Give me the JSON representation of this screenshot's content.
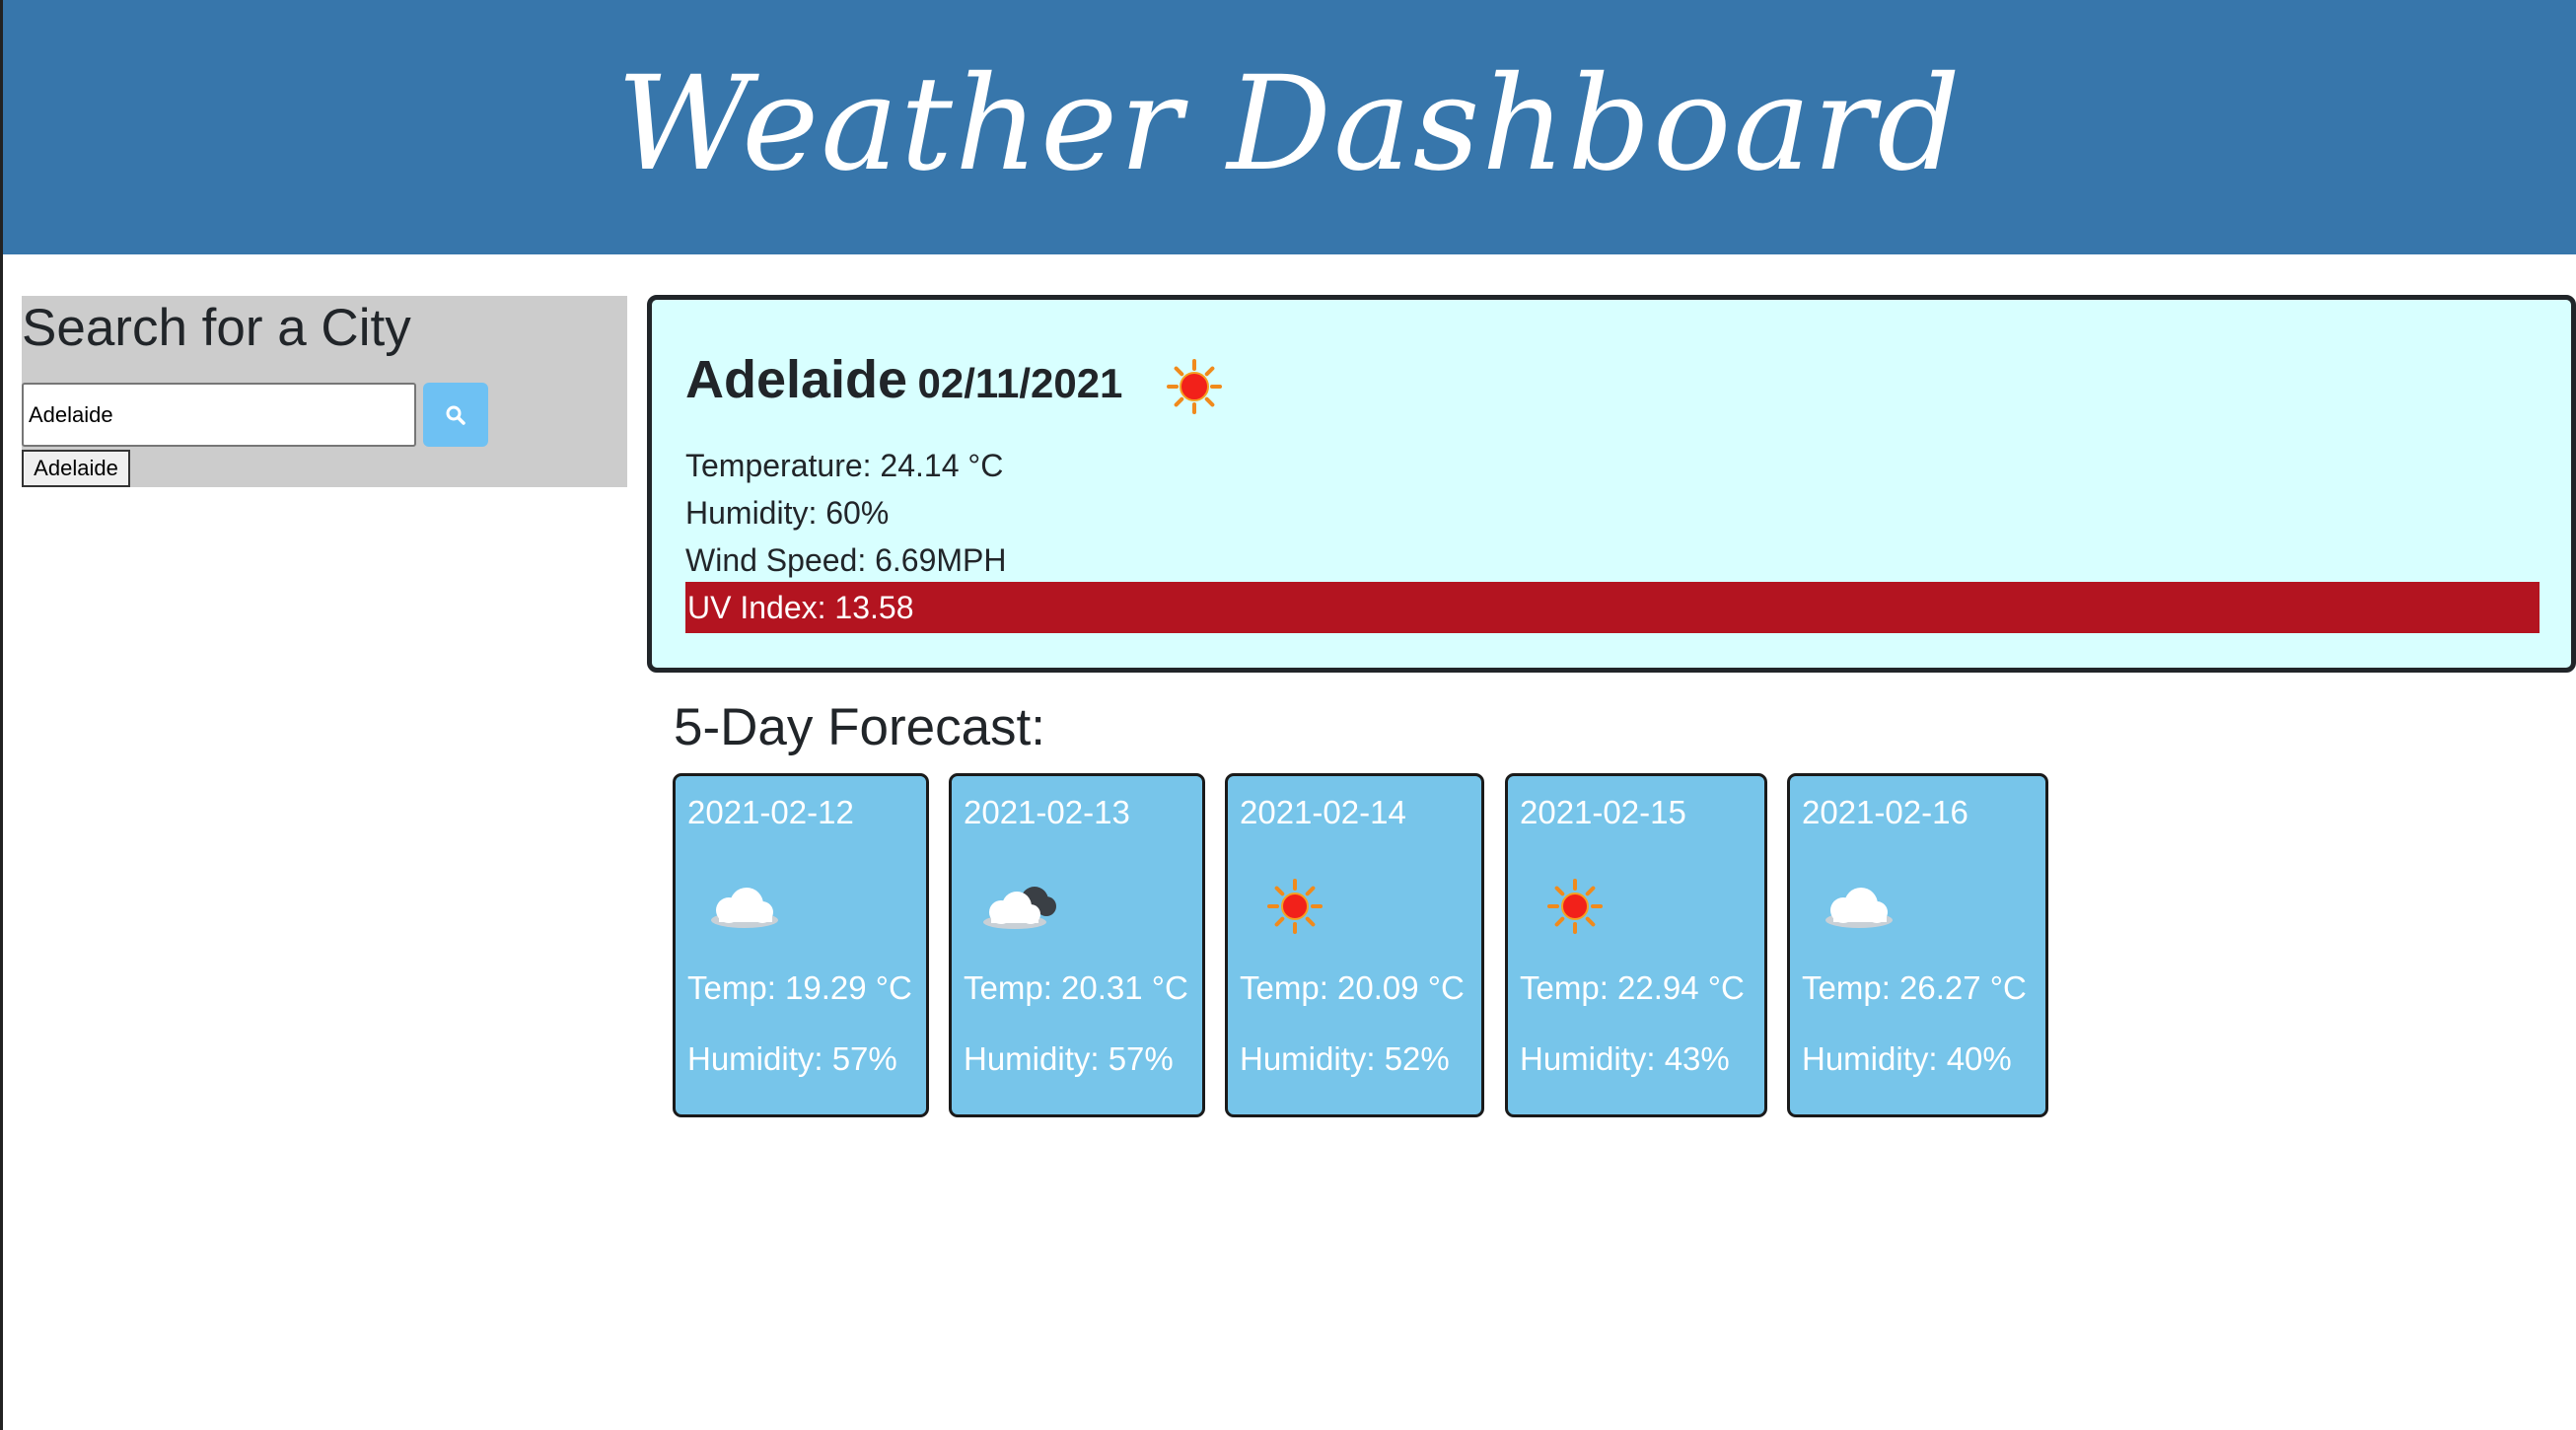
{
  "header": {
    "title": "Weather Dashboard"
  },
  "search": {
    "heading": "Search for a City",
    "input_value": "Adelaide",
    "button_icon": "search-icon",
    "history": [
      {
        "label": "Adelaide"
      }
    ]
  },
  "current": {
    "city": "Adelaide",
    "date": "02/11/2021",
    "icon": "sun-icon",
    "temperature": "Temperature: 24.14 °C",
    "humidity": "Humidity: 60%",
    "wind": "Wind Speed: 6.69MPH",
    "uv": "UV Index: 13.58",
    "uv_color": "#b31420"
  },
  "forecast": {
    "title": "5-Day Forecast:",
    "days": [
      {
        "date": "2021-02-12",
        "icon": "cloud-icon",
        "temp": "Temp: 19.29 °C",
        "humidity": "Humidity: 57%"
      },
      {
        "date": "2021-02-13",
        "icon": "broken-clouds-icon",
        "temp": "Temp: 20.31 °C",
        "humidity": "Humidity: 57%"
      },
      {
        "date": "2021-02-14",
        "icon": "sun-icon",
        "temp": "Temp: 20.09 °C",
        "humidity": "Humidity: 52%"
      },
      {
        "date": "2021-02-15",
        "icon": "sun-icon",
        "temp": "Temp: 22.94 °C",
        "humidity": "Humidity: 43%"
      },
      {
        "date": "2021-02-16",
        "icon": "cloud-icon",
        "temp": "Temp: 26.27 °C",
        "humidity": "Humidity: 40%"
      }
    ]
  },
  "colors": {
    "header_bg": "#3776ab",
    "current_bg": "#d8ffff",
    "card_bg": "#77c5ea",
    "search_button": "#6ec1f3"
  }
}
